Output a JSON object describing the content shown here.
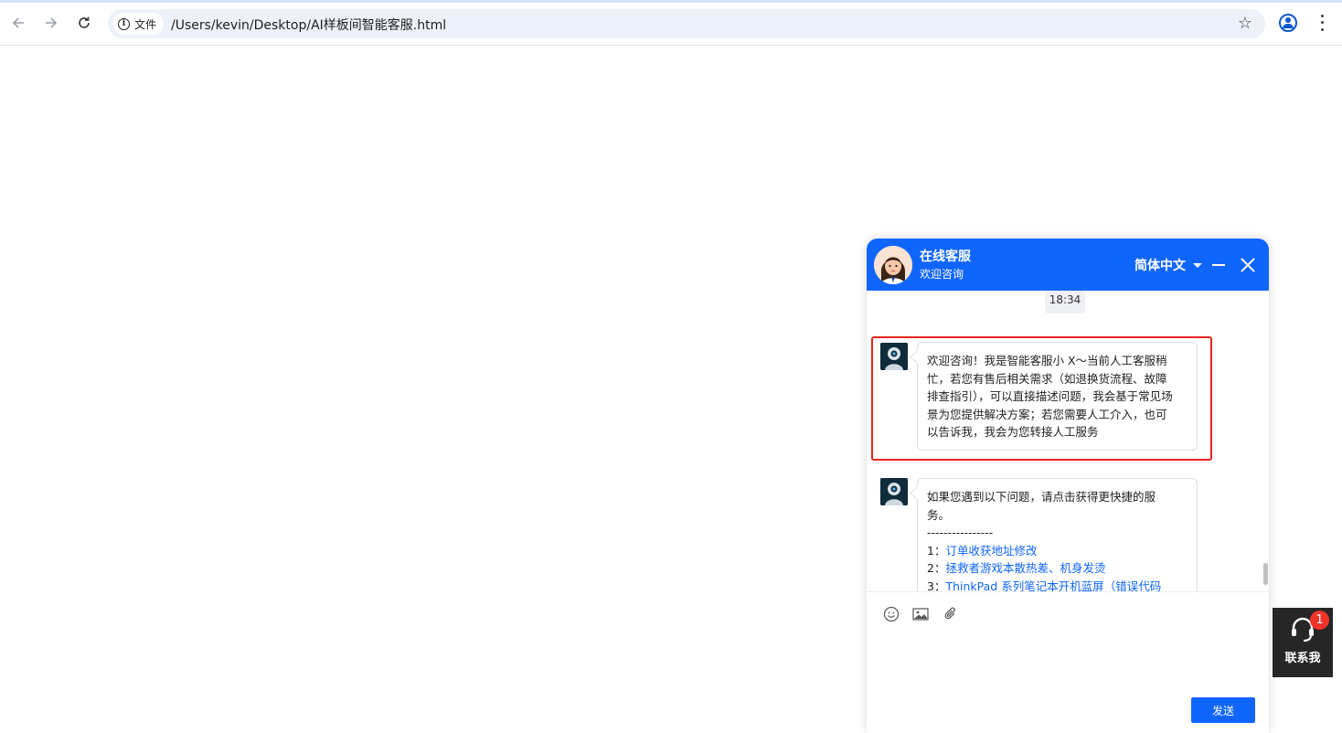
{
  "browser": {
    "address_chip": "文件",
    "url": "/Users/kevin/Desktop/AI样板间智能客服.html"
  },
  "chat": {
    "title": "在线客服",
    "subtitle": "欢迎咨询",
    "language": "简体中文",
    "timestamp": "18:34",
    "messages": [
      {
        "sender": "bot",
        "lines": [
          "欢迎咨询！我是智能客服小 X～当前人工客服稍",
          "忙，若您有售后相关需求（如退换货流程、故障",
          "排查指引），可以直接描述问题，我会基于常见场",
          "景为您提供解决方案；若您需要人工介入，也可",
          "以告诉我，我会为您转接人工服务"
        ]
      },
      {
        "sender": "bot",
        "intro_lines": [
          "如果您遇到以下问题，请点击获得更快捷的服",
          "务。"
        ],
        "divider": "----------------",
        "options": [
          {
            "num": "1：",
            "text": "订单收获地址修改"
          },
          {
            "num": "2：",
            "text": "拯救者游戏本散热差、机身发烫"
          },
          {
            "num": "3：",
            "text": "ThinkPad 系列笔记本开机蓝屏（错误代码"
          }
        ]
      }
    ],
    "toolbar_icons": [
      "emoji-icon",
      "image-icon",
      "attachment-icon"
    ],
    "send_label": "发送"
  },
  "contact": {
    "label": "联系我",
    "badge": "1"
  },
  "colors": {
    "brand_blue": "#1066fc",
    "highlight_red": "#e8251d"
  }
}
